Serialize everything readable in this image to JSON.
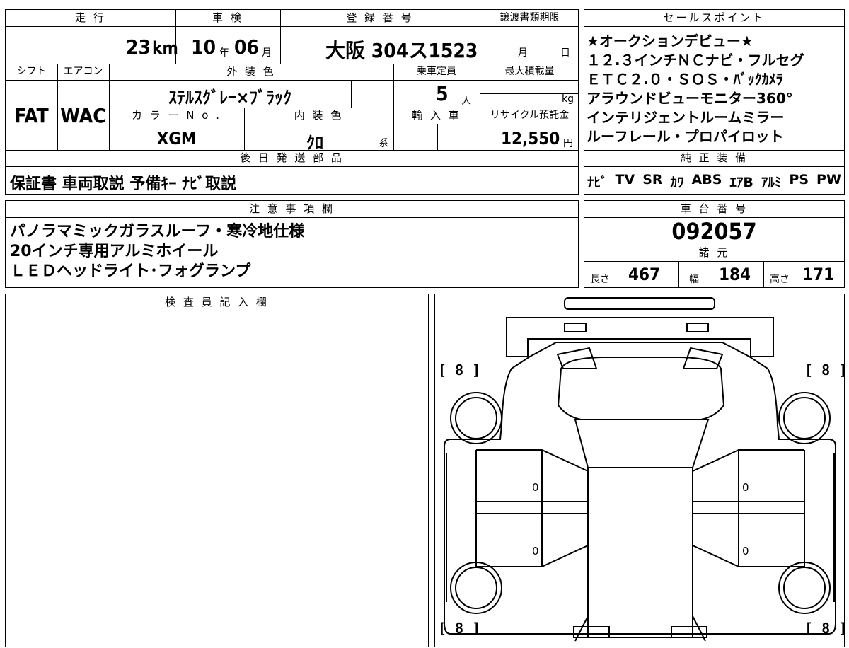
{
  "header": {
    "mileage_label": "走 行",
    "inspection_label": "車 検",
    "registration_label": "登 録 番 号",
    "transfer_deadline_label": "譲渡書類期限",
    "shift_label": "シフト",
    "aircon_label": "エアコン",
    "exterior_color_label": "外 装 色",
    "capacity_label": "乗車定員",
    "max_load_label": "最大積載量",
    "color_no_label": "カ ラ ー N o .",
    "interior_color_label": "内 装 色",
    "import_label": "輸 入 車",
    "recycle_label": "リサイクル預託金",
    "later_parts_label": "後 日 発 送 部 品"
  },
  "values": {
    "mileage": "23",
    "mileage_unit": "km",
    "inspection_year": "10",
    "year_unit": "年",
    "inspection_month": "06",
    "month_unit": "月",
    "registration": "大阪 304ス1523",
    "deadline_month_unit": "月",
    "deadline_day_unit": "日",
    "shift": "FAT",
    "aircon": "WAC",
    "exterior_color": "ｽﾃﾙｽｸﾞﾚｰ×ﾌﾞﾗｯｸ",
    "capacity": "5",
    "capacity_unit": "人",
    "load_unit": "kg",
    "color_no": "XGM",
    "interior_color": "ｸﾛ",
    "interior_suffix": "系",
    "recycle_fee": "12,550",
    "yen_unit": "円",
    "later_parts": "保証書 車両取説 予備ｷｰ ﾅﾋﾞ取説"
  },
  "sales_points": {
    "label": "セールスポイント",
    "lines": [
      "★オークションデビュー★",
      "１２.３インチＮＣナビ・フルセグ",
      "ＥＴＣ２.０・ＳＯＳ・ﾊﾞｯｸｶﾒﾗ",
      "アラウンドビューモニター360°",
      "インテリジェントルームミラー",
      "ルーフレール・プロパイロット"
    ]
  },
  "equipment": {
    "label": "純 正 装 備",
    "items": [
      "ﾅﾋﾞ",
      "TV",
      "SR",
      "ｶﾜ",
      "ABS",
      "ｴｱB",
      "ｱﾙﾐ",
      "PS",
      "PW"
    ]
  },
  "notes": {
    "label": "注 意 事 項 欄",
    "lines": [
      "パノラマミックガラスルーフ・寒冷地仕様",
      "20インチ専用アルミホイール",
      "ＬＥＤヘッドライト･フォグランプ"
    ]
  },
  "chassis": {
    "label": "車 台 番 号",
    "number": "092057"
  },
  "specs": {
    "label": "諸 元",
    "length_label": "長さ",
    "length": "467",
    "width_label": "幅",
    "width": "184",
    "height_label": "高さ",
    "height": "171"
  },
  "inspector": {
    "label": "検 査 員 記 入 欄"
  },
  "diagram": {
    "tread_front_left": "[ 8 ]",
    "tread_front_right": "[ 8 ]",
    "tread_rear_left": "[ 8 ]",
    "tread_rear_right": "[ 8 ]",
    "door_fl": "0",
    "door_fr": "0",
    "door_rl": "0",
    "door_rr": "0"
  }
}
